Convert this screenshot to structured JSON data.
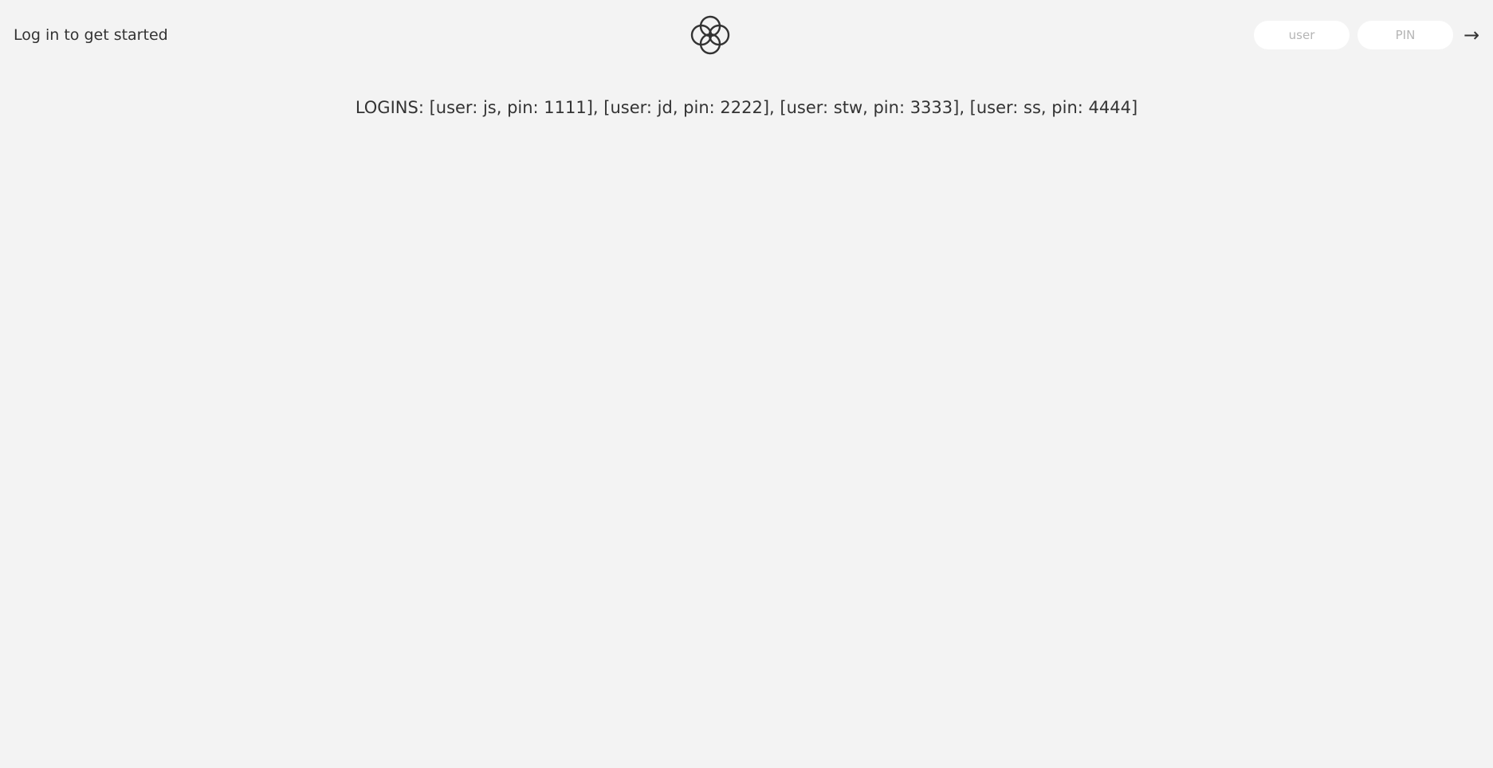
{
  "header": {
    "welcome_label": "Log in to get started",
    "logo_icon": "overlapping-circles-logo-icon",
    "user_placeholder": "user",
    "pin_placeholder": "PIN",
    "login_button_label": "→"
  },
  "main": {
    "logins_hint": "LOGINS: [user: js, pin: 1111], [user: jd, pin: 2222], [user: stw, pin: 3333], [user: ss, pin: 4444]"
  },
  "colors": {
    "background": "#f3f3f3",
    "text": "#333333",
    "input_background": "#ffffff",
    "placeholder": "#b5b5b5"
  }
}
